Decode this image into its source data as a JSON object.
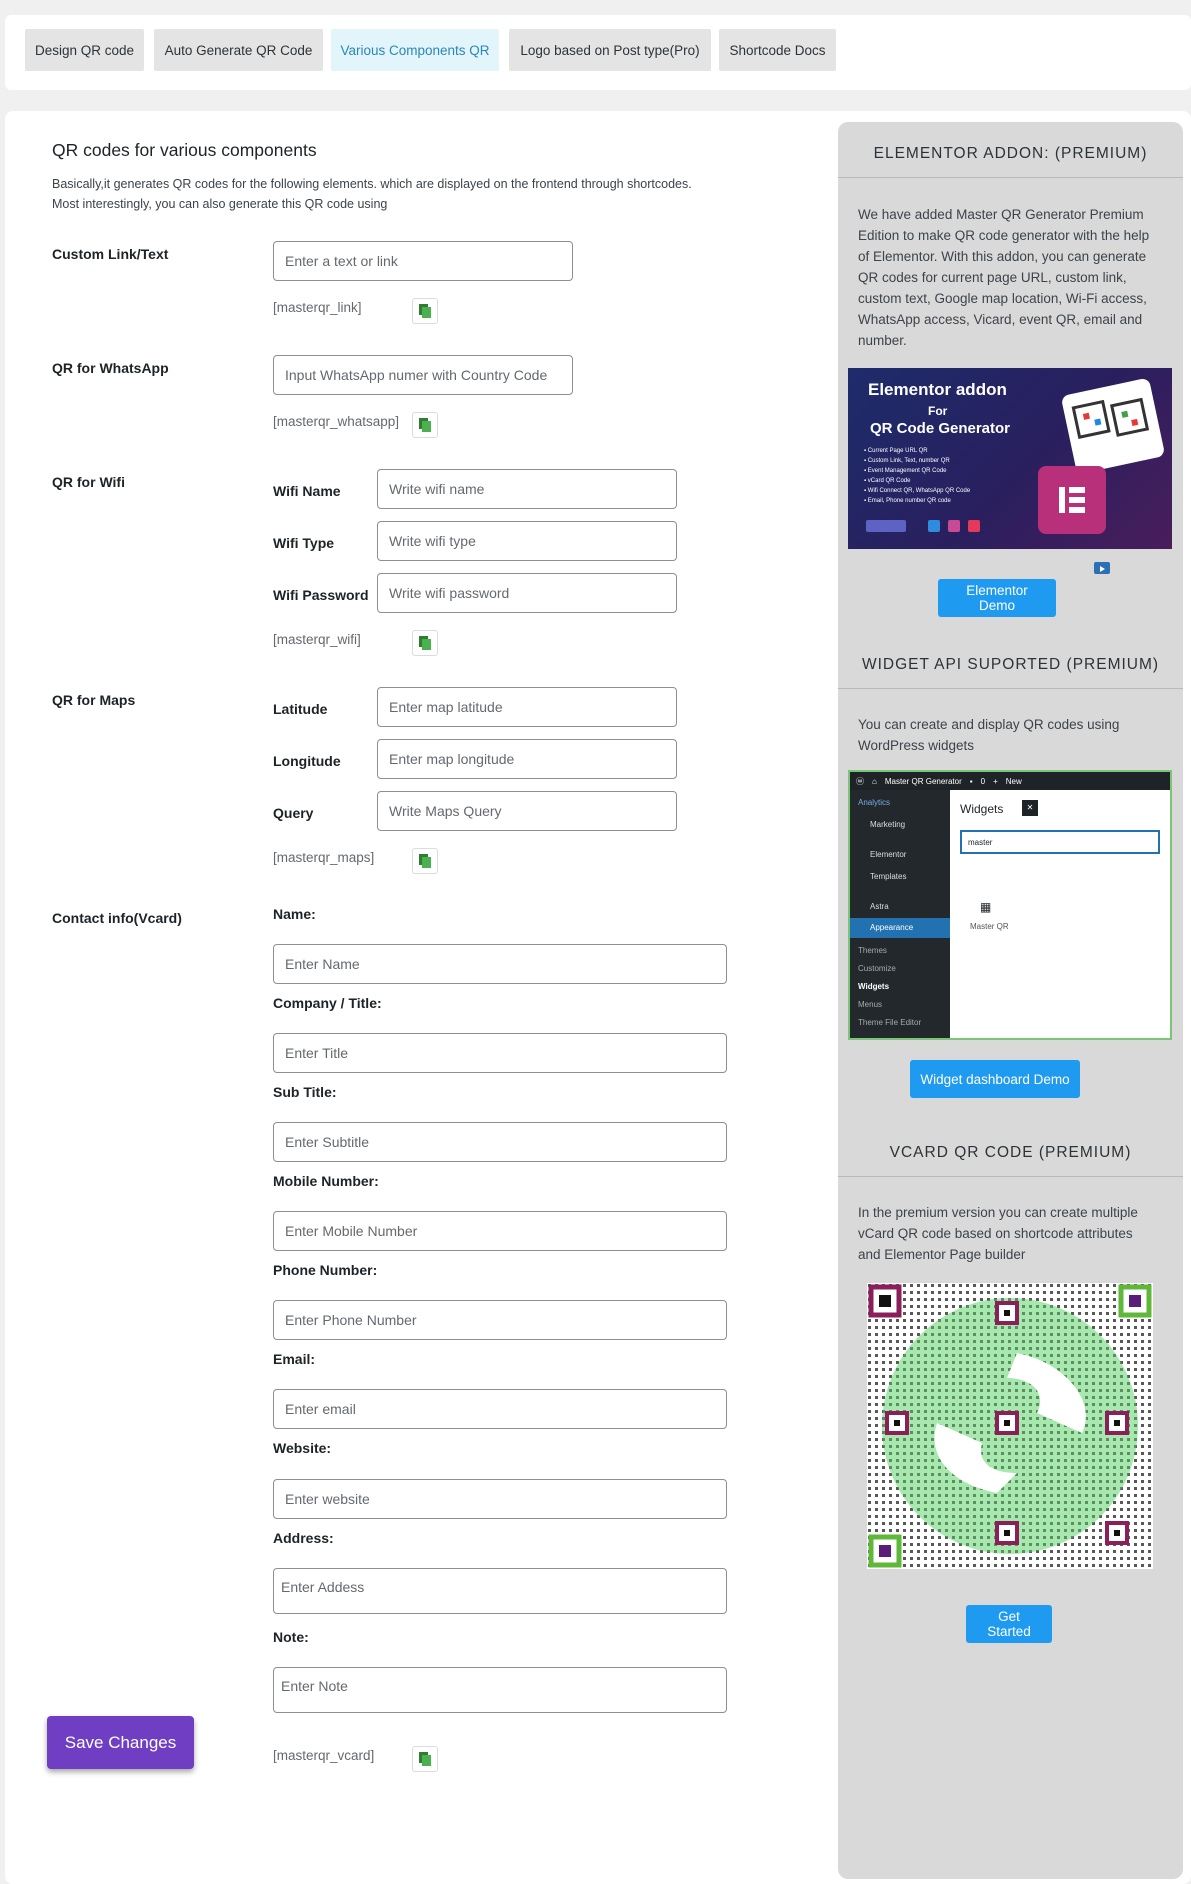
{
  "tabs": [
    {
      "label": "Design QR code"
    },
    {
      "label": "Auto Generate QR Code"
    },
    {
      "label": "Various Components QR"
    },
    {
      "label": "Logo based on Post type(Pro)"
    },
    {
      "label": "Shortcode Docs"
    }
  ],
  "main": {
    "title": "QR codes for various components",
    "desc_line1": "Basically,it generates QR codes for the following elements. which are displayed on the frontend through shortcodes.",
    "desc_line2": "Most interestingly, you can also generate this QR code using",
    "custom_link": {
      "label": "Custom Link/Text",
      "placeholder": "Enter a text or link",
      "shortcode": "[masterqr_link]"
    },
    "whatsapp": {
      "label": "QR for WhatsApp",
      "placeholder": "Input WhatsApp numer with Country Code",
      "shortcode": "[masterqr_whatsapp]"
    },
    "wifi": {
      "label": "QR for Wifi",
      "name_label": "Wifi Name",
      "name_placeholder": "Write wifi name",
      "type_label": "Wifi Type",
      "type_placeholder": "Write wifi type",
      "password_label": "Wifi Password",
      "password_placeholder": "Write wifi password",
      "shortcode": "[masterqr_wifi]"
    },
    "maps": {
      "label": "QR for Maps",
      "lat_label": "Latitude",
      "lat_placeholder": "Enter map latitude",
      "lng_label": "Longitude",
      "lng_placeholder": "Enter map longitude",
      "query_label": "Query",
      "query_placeholder": "Write Maps Query",
      "shortcode": "[masterqr_maps]"
    },
    "vcard": {
      "label": "Contact info(Vcard)",
      "name_label": "Name:",
      "name_placeholder": "Enter Name",
      "title_label": "Company / Title:",
      "title_placeholder": "Enter Title",
      "subtitle_label": "Sub Title:",
      "subtitle_placeholder": "Enter Subtitle",
      "mobile_label": "Mobile Number:",
      "mobile_placeholder": "Enter Mobile Number",
      "phone_label": "Phone Number:",
      "phone_placeholder": "Enter Phone Number",
      "email_label": "Email:",
      "email_placeholder": "Enter email",
      "website_label": "Website:",
      "website_placeholder": "Enter website",
      "address_label": "Address:",
      "address_placeholder": "Enter Addess",
      "note_label": "Note:",
      "note_placeholder": "Enter Note",
      "shortcode": "[masterqr_vcard]"
    },
    "save_label": "Save Changes"
  },
  "sidebar": {
    "elementor": {
      "heading": "ELEMENTOR ADDON: (PREMIUM)",
      "text": "We have added Master QR Generator Premium Edition to make QR code generator with the help of Elementor. With this addon, you can generate QR codes for current page URL, custom link, custom text, Google map location, Wi-Fi access, WhatsApp access, Vicard, event QR, email and number.",
      "banner_title": "Elementor addon",
      "banner_for": "For",
      "banner_subtitle": "QR Code Generator",
      "banner_items": [
        "Current Page URL QR",
        "Custom Link, Text, number QR",
        "Event Management QR Code",
        "vCard QR Code",
        "Wifi Connect QR, WhatsApp QR Code",
        "Email, Phone number QR code"
      ],
      "button": "Elementor Demo"
    },
    "widget": {
      "heading": "WIDGET API SUPORTED (PREMIUM)",
      "text": "You can create and display QR codes using WordPress widgets",
      "wp_site": "Master QR Generator",
      "wp_comments": "0",
      "wp_new": "New",
      "wp_menu": [
        "Analytics",
        "Marketing",
        "Elementor",
        "Templates",
        "Astra",
        "Appearance"
      ],
      "wp_submenu": [
        "Themes",
        "Customize",
        "Widgets",
        "Menus",
        "Theme File Editor"
      ],
      "widgets_title": "Widgets",
      "search_value": "master",
      "widget_name": "Master QR",
      "button": "Widget dashboard Demo"
    },
    "vcard": {
      "heading": "VCARD QR CODE (PREMIUM)",
      "text": "In the premium version you can create multiple vCard QR code based on shortcode attributes and Elementor Page builder",
      "button": "Get Started"
    }
  },
  "colors": {
    "accent_purple": "#6f3ec2",
    "button_blue": "#1e9bf0",
    "copy_green": "#4caf50",
    "qr_green": "#9be7a4",
    "qr_frame_maroon": "#8a1f5a"
  }
}
